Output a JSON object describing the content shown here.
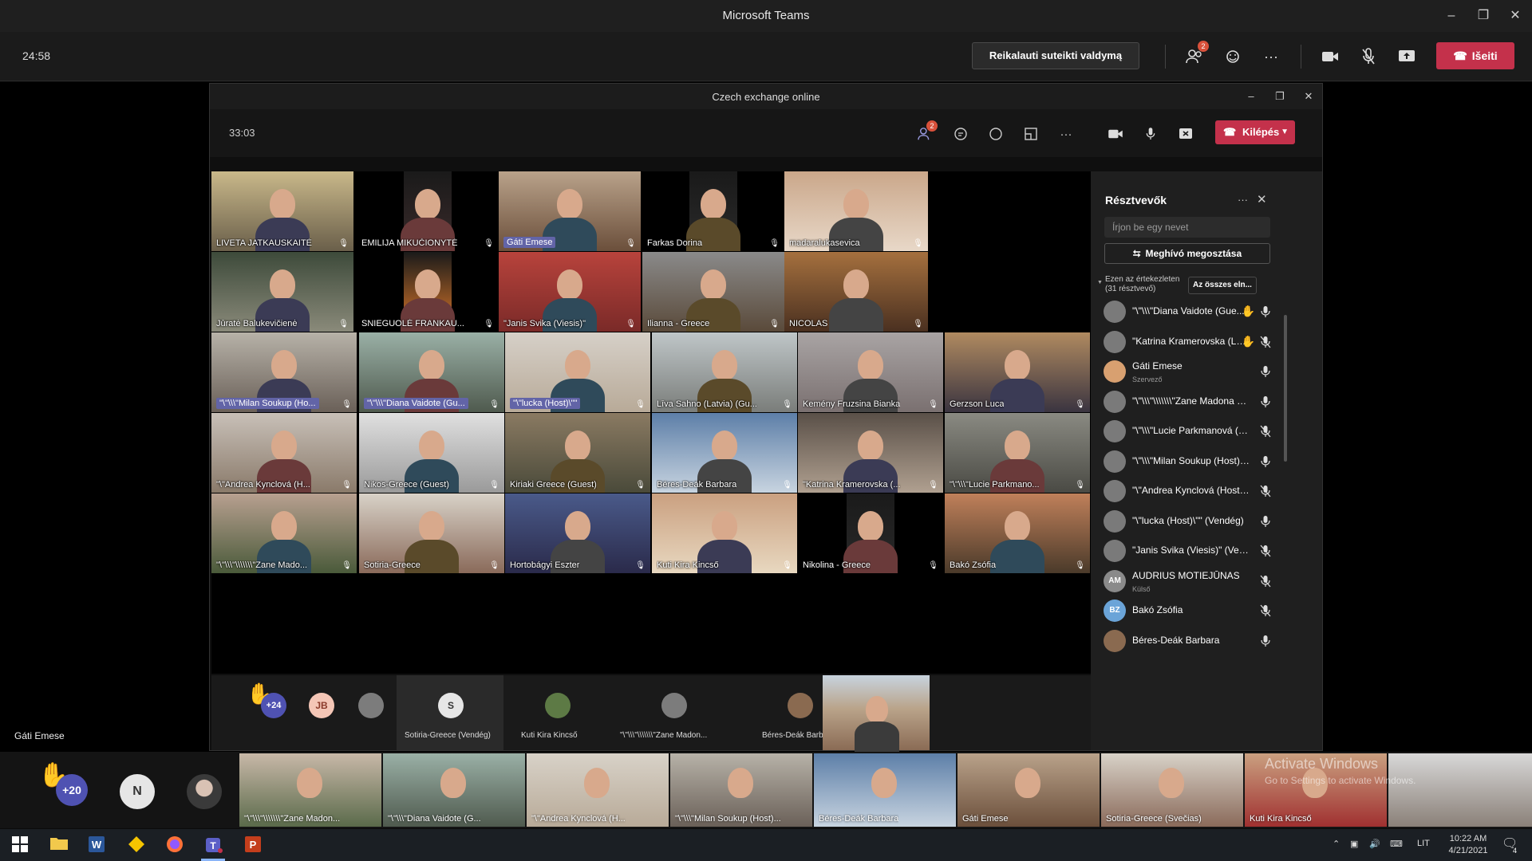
{
  "window": {
    "title": "Microsoft Teams"
  },
  "toolbar": {
    "timer": "24:58",
    "take_control_label": "Reikalauti suteikti valdymą",
    "participants_badge": "2",
    "leave_label": "Išeiti",
    "more_label": "···"
  },
  "presenter": {
    "name": "Gáti Emese"
  },
  "inner": {
    "title": "Czech exchange online",
    "timer": "33:03",
    "participants_badge": "2",
    "leave_label": "Kilépés",
    "more_label": "···"
  },
  "tiles": [
    {
      "label": "LIVETA JATKAUSKAITĖ"
    },
    {
      "label": "EMILIJA MIKUČIONYTĖ"
    },
    {
      "label": "Gáti Emese"
    },
    {
      "label": "Farkas Dorina"
    },
    {
      "label": "madaralukasevica"
    },
    {
      "label": "Jūratė Balukevičienė"
    },
    {
      "label": "SNIEGUOLĖ FRANKAU..."
    },
    {
      "label": "\"Janis Svika (Viesis)\""
    },
    {
      "label": "Ilianna - Greece"
    },
    {
      "label": "NICOLAS"
    },
    {
      "label": "\"\\\"\\\\\\\"Milan Soukup (Ho..."
    },
    {
      "label": "\"\\\"\\\\\\\"Diana Vaidote (Gu..."
    },
    {
      "label": "\"\\\"lucka (Host)\\\"\""
    },
    {
      "label": "Līva Sahno (Latvia) (Gu..."
    },
    {
      "label": "Kemény Fruzsina Bianka"
    },
    {
      "label": "Gerzson Luca"
    },
    {
      "label": "\"\\\"Andrea Kynclová (H..."
    },
    {
      "label": "Nikos-Greece (Guest)"
    },
    {
      "label": "Kiriaki Greece (Guest)"
    },
    {
      "label": "Béres-Deák Barbara"
    },
    {
      "label": "\"Katrina Kramerovska (..."
    },
    {
      "label": "\"\\\"\\\\\\\"Lucie Parkmano..."
    },
    {
      "label": "\"\\\"\\\\\\\"\\\\\\\\\\\\\\\"Zane Mado..."
    },
    {
      "label": "Sotiria-Greece"
    },
    {
      "label": "Hortobágyi Eszter"
    },
    {
      "label": "Kuti Kira Kincső"
    },
    {
      "label": "Nikolina - Greece"
    },
    {
      "label": "Bakó Zsófia"
    }
  ],
  "inner_strip": {
    "raised_count": "+24",
    "jb_initials": "JB",
    "s_initial": "S",
    "cells": [
      {
        "label": "Sotiria-Greece (Vendég)"
      },
      {
        "label": "Kuti Kira Kincső"
      },
      {
        "label": "\"\\\"\\\\\\\"\\\\\\\\\\\\\\\"Zane Madon..."
      },
      {
        "label": "Béres-Deák Barbara"
      }
    ]
  },
  "panel": {
    "title": "Résztvevők",
    "search_placeholder": "Írjon be egy nevet",
    "invite_label": "Meghívó megosztása",
    "section_label": "Ezen az értekezleten (31 résztvevő)",
    "mute_all_label": "Az összes eln...",
    "more_label": "···",
    "participants": [
      {
        "name": "\"\\\"\\\\\\\"Diana Vaidote (Gue...",
        "sub": "",
        "hand": true,
        "muted": false,
        "initials": ""
      },
      {
        "name": "\"Katrina Kramerovska (Lat...",
        "sub": "",
        "hand": true,
        "muted": true,
        "initials": ""
      },
      {
        "name": "Gáti Emese",
        "sub": "Szervező",
        "hand": false,
        "muted": false,
        "initials": ""
      },
      {
        "name": "\"\\\"\\\\\\\"\\\\\\\\\\\\\\\"Zane Madona St...",
        "sub": "",
        "hand": false,
        "muted": false,
        "initials": ""
      },
      {
        "name": "\"\\\"\\\\\\\"Lucie Parkmanová (Hos...",
        "sub": "",
        "hand": false,
        "muted": true,
        "initials": ""
      },
      {
        "name": "\"\\\"\\\\\\\"Milan Soukup (Host)\\\\...",
        "sub": "",
        "hand": false,
        "muted": false,
        "initials": ""
      },
      {
        "name": "\"\\\"Andrea Kynclová (Host)\\\"\" (...",
        "sub": "",
        "hand": false,
        "muted": true,
        "initials": ""
      },
      {
        "name": "\"\\\"lucka (Host)\\\"\" (Vendég)",
        "sub": "",
        "hand": false,
        "muted": false,
        "initials": ""
      },
      {
        "name": "\"Janis Svika (Viesis)\" (Vendég)",
        "sub": "",
        "hand": false,
        "muted": true,
        "initials": ""
      },
      {
        "name": "AUDRIUS MOTIEJŪNAS",
        "sub": "Külső",
        "hand": false,
        "muted": true,
        "initials": "AM"
      },
      {
        "name": "Bakó Zsófia",
        "sub": "",
        "hand": false,
        "muted": true,
        "initials": "BZ"
      },
      {
        "name": "Béres-Deák Barbara",
        "sub": "",
        "hand": false,
        "muted": false,
        "initials": ""
      }
    ]
  },
  "bottom_strip": {
    "raised_count": "+20",
    "n_initial": "N",
    "tiles": [
      {
        "label": "\"\\\"\\\\\\\"\\\\\\\\\\\\\\\"Zane Madon..."
      },
      {
        "label": "\"\\\"\\\\\\\"Diana Vaidote (G..."
      },
      {
        "label": "\"\\\"Andrea Kynclová (H..."
      },
      {
        "label": "\"\\\"\\\\\\\"Milan Soukup (Host)..."
      },
      {
        "label": "Béres-Deák Barbara"
      },
      {
        "label": "Gáti Emese"
      },
      {
        "label": "Sotiria-Greece (Svečias)"
      },
      {
        "label": "Kuti Kira Kincső"
      }
    ],
    "watermark_line1": "Activate Windows",
    "watermark_line2": "Go to Settings to activate Windows."
  },
  "taskbar": {
    "lang": "LIT",
    "time": "10:22 AM",
    "date": "4/21/2021",
    "notif_count": "4"
  },
  "colors": {
    "accent": "#6264a7",
    "leave": "#c4314b",
    "badge": "#d9513b"
  }
}
